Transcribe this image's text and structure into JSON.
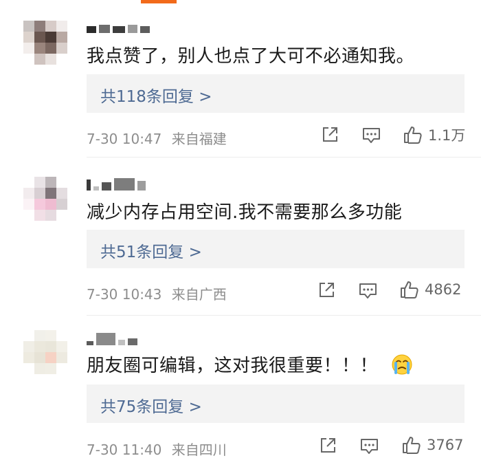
{
  "comments": [
    {
      "text": "我点赞了，别人也点了大可不必通知我。",
      "replies_label": "共118条回复 >",
      "date": "7-30 10:47",
      "location": "来自福建",
      "likes": "1.1万"
    },
    {
      "text": "减少内存占用空间.我不需要那么多功能",
      "replies_label": "共51条回复 >",
      "date": "7-30 10:43",
      "location": "来自广西",
      "likes": "4862"
    },
    {
      "text": "朋友圈可编辑，这对我很重要！！！",
      "replies_label": "共75条回复 >",
      "date": "7-30 11:40",
      "location": "来自四川",
      "likes": "3767"
    }
  ],
  "icons": {
    "share": "share-icon",
    "comment": "comment-icon",
    "like": "thumbs-up-icon",
    "emoji": "crying-face-emoji"
  },
  "colors": {
    "reply_link": "#4e6a93",
    "meta": "#8d8d8d",
    "accent": "#f26a1b"
  }
}
